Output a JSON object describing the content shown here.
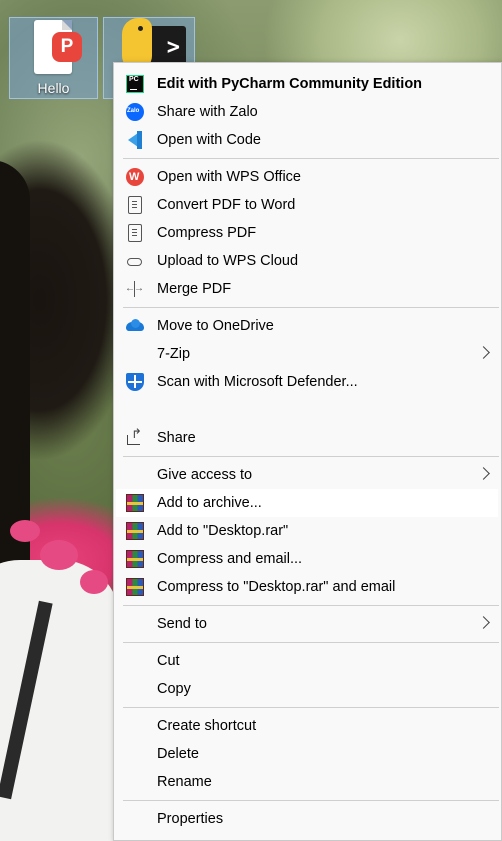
{
  "desktop": {
    "icons": [
      {
        "label": "Hello"
      },
      {
        "label": ""
      }
    ]
  },
  "context_menu": {
    "items": [
      {
        "label": "Edit with PyCharm Community Edition",
        "icon": "pycharm-icon",
        "bold": true
      },
      {
        "label": "Share with Zalo",
        "icon": "zalo-icon"
      },
      {
        "label": "Open with Code",
        "icon": "vscode-icon"
      },
      {
        "label": "Open with WPS Office",
        "icon": "wps-office-icon"
      },
      {
        "label": "Convert PDF to Word",
        "icon": "pdf-to-word-icon"
      },
      {
        "label": "Compress PDF",
        "icon": "compress-pdf-icon"
      },
      {
        "label": "Upload to WPS Cloud",
        "icon": "cloud-icon"
      },
      {
        "label": "Merge PDF",
        "icon": "merge-pdf-icon"
      },
      {
        "label": "Move to OneDrive",
        "icon": "onedrive-icon"
      },
      {
        "label": "7-Zip",
        "submenu": true
      },
      {
        "label": "Scan with Microsoft Defender...",
        "icon": "defender-shield-icon"
      },
      {
        "label": "Share",
        "icon": "share-icon"
      },
      {
        "label": "Give access to",
        "submenu": true
      },
      {
        "label": "Add to archive...",
        "icon": "winrar-icon",
        "highlighted": true
      },
      {
        "label": "Add to \"Desktop.rar\"",
        "icon": "winrar-icon"
      },
      {
        "label": "Compress and email...",
        "icon": "winrar-icon"
      },
      {
        "label": "Compress to \"Desktop.rar\" and email",
        "icon": "winrar-icon"
      },
      {
        "label": "Send to",
        "submenu": true
      },
      {
        "label": "Cut"
      },
      {
        "label": "Copy"
      },
      {
        "label": "Create shortcut"
      },
      {
        "label": "Delete"
      },
      {
        "label": "Rename"
      },
      {
        "label": "Properties"
      }
    ]
  }
}
